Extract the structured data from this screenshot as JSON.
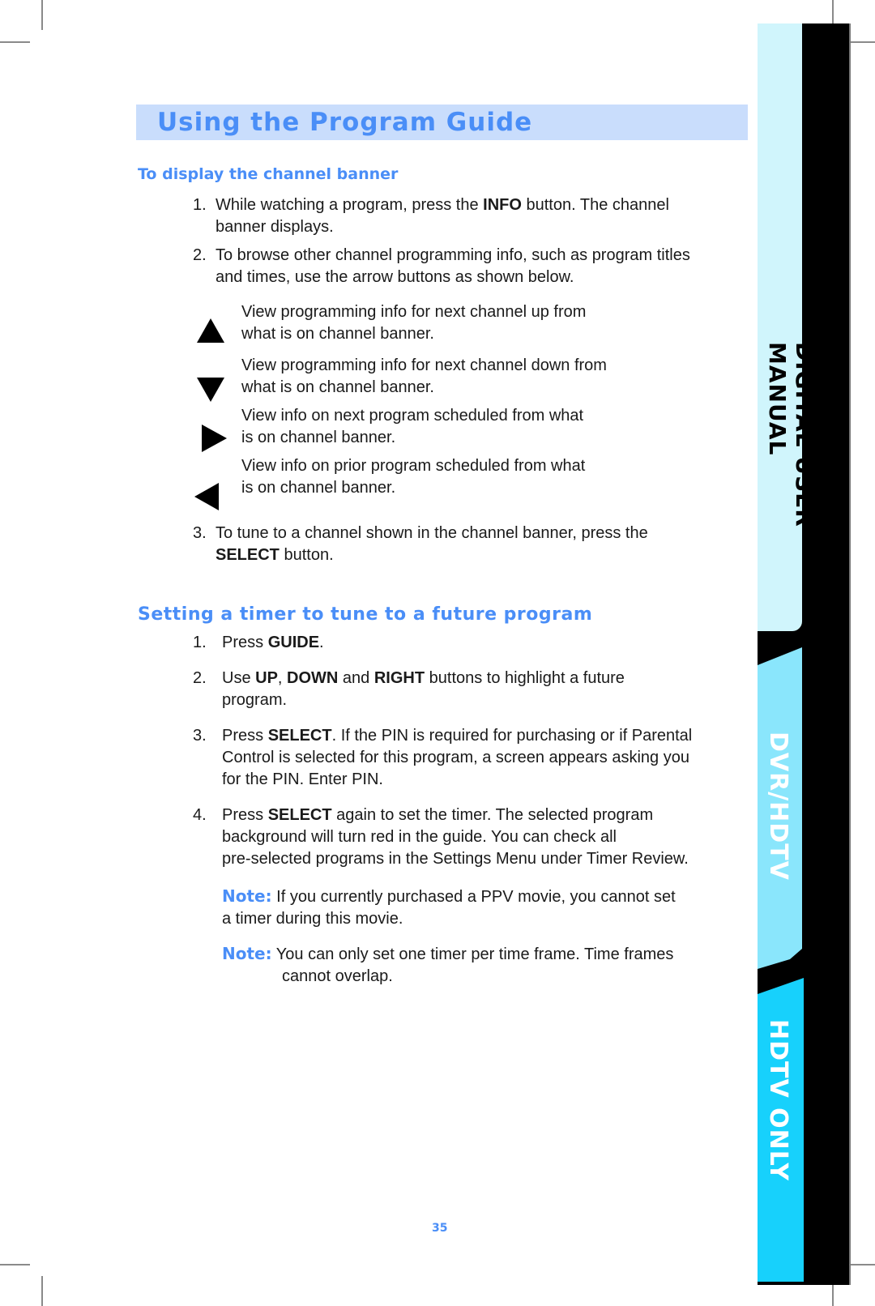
{
  "page": {
    "title": "Using the Program Guide",
    "page_number": "35"
  },
  "section1": {
    "heading": "To display the channel banner",
    "steps": [
      {
        "num": "1.",
        "pre": "While watching a program, press the ",
        "bold": "INFO",
        "post": " button. The channel",
        "line2": "banner displays."
      },
      {
        "num": "2.",
        "line1": "To browse other channel programming info, such as program titles",
        "line2": "and times, use the arrow buttons as shown below."
      }
    ],
    "arrows": [
      {
        "icon": "up-arrow-icon",
        "line1": "View programming info for next channel up from",
        "line2": "what is on channel banner."
      },
      {
        "icon": "down-arrow-icon",
        "line1": "View programming info for next channel down from",
        "line2": "what is on channel banner."
      },
      {
        "icon": "right-arrow-icon",
        "line1": "View info on next program scheduled from what",
        "line2": "is on channel banner."
      },
      {
        "icon": "left-arrow-icon",
        "line1": "View info on prior program scheduled from what",
        "line2": "is on channel banner."
      }
    ],
    "step3": {
      "num": "3.",
      "line1": "To tune to a channel shown in the channel banner, press the",
      "bold": "SELECT",
      "post": " button."
    }
  },
  "section2": {
    "heading": "Setting a timer to tune to a future program",
    "steps": [
      {
        "num": "1.",
        "pre": "Press ",
        "bold": "GUIDE",
        "post": "."
      },
      {
        "num": "2.",
        "pre": "Use ",
        "b1": "UP",
        "m1": ", ",
        "b2": "DOWN",
        "m2": " and ",
        "b3": "RIGHT",
        "post": " buttons to highlight a future",
        "line2": "program."
      },
      {
        "num": "3.",
        "pre": "Press ",
        "bold": "SELECT",
        "post": ". If the PIN is required for purchasing or if Parental",
        "line2": "Control is selected for this program, a screen appears asking you",
        "line3": "for the PIN. Enter PIN."
      },
      {
        "num": "4.",
        "pre": "Press ",
        "bold": "SELECT",
        "post": " again to set the timer. The selected program",
        "line2": "background will turn red in the guide. You can check all",
        "line3": "pre-selected programs in the Settings Menu under Timer Review."
      }
    ],
    "notes": [
      {
        "label": "Note:",
        "line1": " If you currently purchased a PPV movie, you cannot set",
        "line2": "a timer during this movie."
      },
      {
        "label": "Note:",
        "line1": " You can only set one timer per time frame. Time frames",
        "line2": "cannot overlap."
      }
    ]
  },
  "side_tabs": [
    {
      "label": "DIGITAL USER MANUAL",
      "color": "#d0f5fc"
    },
    {
      "label": "DVR/HDTV",
      "color": "#8ae6fc"
    },
    {
      "label": "HDTV ONLY",
      "color": "#17d1fc"
    }
  ],
  "colors": {
    "accent": "#4a8ef7",
    "title_bg": "#c9ddfc"
  }
}
